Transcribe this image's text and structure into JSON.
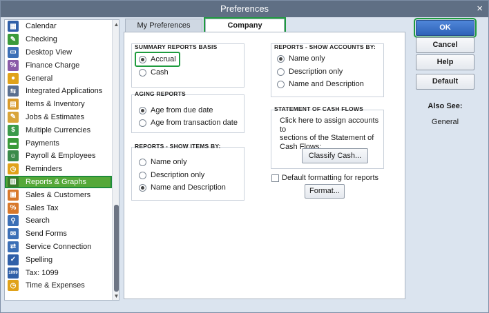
{
  "window": {
    "title": "Preferences",
    "close_glyph": "×"
  },
  "sidebar": {
    "items": [
      {
        "label": "Calendar",
        "icon": "calendar-icon",
        "color": "#2f5fa8",
        "glyph": "▦"
      },
      {
        "label": "Checking",
        "icon": "checking-icon",
        "color": "#3a9a3a",
        "glyph": "✎"
      },
      {
        "label": "Desktop View",
        "icon": "desktop-icon",
        "color": "#3b6fb6",
        "glyph": "▭"
      },
      {
        "label": "Finance Charge",
        "icon": "finance-charge-icon",
        "color": "#8a5aa8",
        "glyph": "%"
      },
      {
        "label": "General",
        "icon": "general-icon",
        "color": "#e0a21a",
        "glyph": "●"
      },
      {
        "label": "Integrated Applications",
        "icon": "integrated-apps-icon",
        "color": "#5a6f90",
        "glyph": "⇆"
      },
      {
        "label": "Items & Inventory",
        "icon": "items-inventory-icon",
        "color": "#d89a2a",
        "glyph": "▤"
      },
      {
        "label": "Jobs & Estimates",
        "icon": "jobs-estimates-icon",
        "color": "#d8a43a",
        "glyph": "✎"
      },
      {
        "label": "Multiple Currencies",
        "icon": "currencies-icon",
        "color": "#3a9a4a",
        "glyph": "$"
      },
      {
        "label": "Payments",
        "icon": "payments-icon",
        "color": "#3a9a3a",
        "glyph": "▬"
      },
      {
        "label": "Payroll & Employees",
        "icon": "payroll-icon",
        "color": "#3a8a4a",
        "glyph": "☺"
      },
      {
        "label": "Reminders",
        "icon": "reminders-icon",
        "color": "#e0a21a",
        "glyph": "◷"
      },
      {
        "label": "Reports & Graphs",
        "icon": "reports-graphs-icon",
        "color": "#3a7a2a",
        "glyph": "▥"
      },
      {
        "label": "Sales & Customers",
        "icon": "sales-customers-icon",
        "color": "#d8782a",
        "glyph": "▣"
      },
      {
        "label": "Sales Tax",
        "icon": "sales-tax-icon",
        "color": "#d8782a",
        "glyph": "%"
      },
      {
        "label": "Search",
        "icon": "search-icon",
        "color": "#3b6fb6",
        "glyph": "⚲"
      },
      {
        "label": "Send Forms",
        "icon": "send-forms-icon",
        "color": "#3b6fb6",
        "glyph": "✉"
      },
      {
        "label": "Service Connection",
        "icon": "service-connection-icon",
        "color": "#3b6fb6",
        "glyph": "⇄"
      },
      {
        "label": "Spelling",
        "icon": "spelling-icon",
        "color": "#2f5fa8",
        "glyph": "✓"
      },
      {
        "label": "Tax: 1099",
        "icon": "tax-1099-icon",
        "color": "#2f5fa8",
        "glyph": "1099"
      },
      {
        "label": "Time & Expenses",
        "icon": "time-expenses-icon",
        "color": "#e0a21a",
        "glyph": "◷"
      }
    ],
    "selected_index": 12
  },
  "tabs": {
    "my_preferences": "My Preferences",
    "company_preferences": "Company Preferences"
  },
  "summary_basis": {
    "title": "SUMMARY REPORTS BASIS",
    "options": [
      "Accrual",
      "Cash"
    ],
    "selected": "Accrual"
  },
  "aging": {
    "title": "AGING REPORTS",
    "options": [
      "Age from due date",
      "Age from transaction date"
    ],
    "selected": "Age from due date"
  },
  "items_by": {
    "title": "REPORTS - SHOW ITEMS BY:",
    "options": [
      "Name only",
      "Description only",
      "Name and Description"
    ],
    "selected": "Name and Description"
  },
  "accounts_by": {
    "title": "REPORTS -  SHOW ACCOUNTS BY:",
    "options": [
      "Name only",
      "Description only",
      "Name and Description"
    ],
    "selected": "Name only"
  },
  "cash_flows": {
    "title": "STATEMENT OF CASH FLOWS",
    "text_line1": "Click here to assign accounts to",
    "text_line2": "sections of the Statement of",
    "text_line3": "Cash Flows:",
    "button": "Classify Cash..."
  },
  "default_formatting": {
    "label": "Default formatting for reports",
    "checked": false,
    "button": "Format..."
  },
  "right_buttons": {
    "ok": "OK",
    "cancel": "Cancel",
    "help": "Help",
    "default": "Default"
  },
  "also_see": {
    "title": "Also See:",
    "link": "General"
  }
}
